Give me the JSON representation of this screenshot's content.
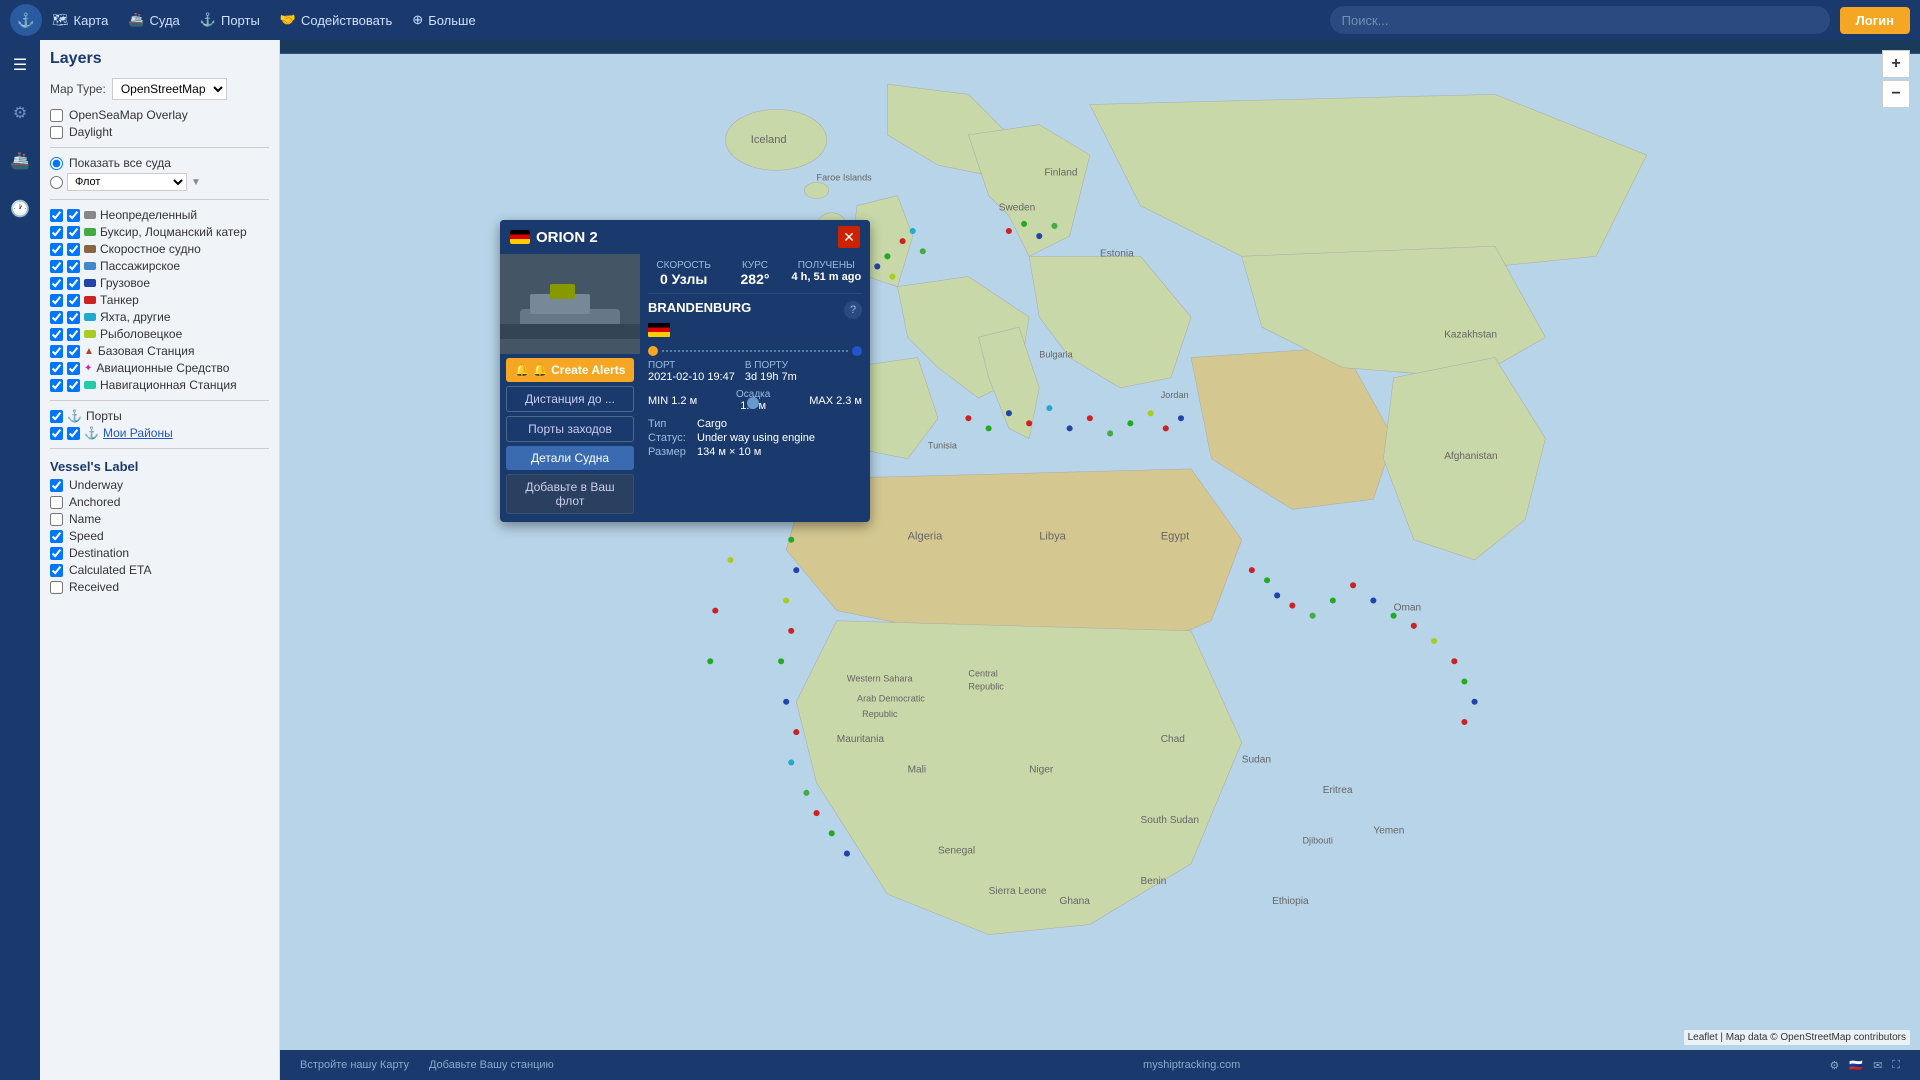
{
  "topnav": {
    "logo": "⚓",
    "items": [
      {
        "label": "Карта",
        "icon": "🗺"
      },
      {
        "label": "Суда",
        "icon": "🚢"
      },
      {
        "label": "Порты",
        "icon": "⚓"
      },
      {
        "label": "Содействовать",
        "icon": "🤝"
      },
      {
        "label": "Больше",
        "icon": "⊕"
      }
    ],
    "search_placeholder": "Поиск...",
    "login_label": "Логин"
  },
  "layers_panel": {
    "title": "Layers",
    "map_type_label": "Map Type:",
    "map_type_value": "OpenStreetMap",
    "overlays": [
      {
        "label": "OpenSeaMap Overlay",
        "checked": false
      },
      {
        "label": "Daylight",
        "checked": false
      }
    ],
    "show_all_label": "Показать все суда",
    "fleet_label": "Флот",
    "vessel_types": [
      {
        "label": "Неопределенный",
        "color": "#888888",
        "type": "bar"
      },
      {
        "label": "Буксир, Лоцманский катер",
        "color": "#44aa44",
        "type": "bar"
      },
      {
        "label": "Скоростное судно",
        "color": "#886644",
        "type": "bar"
      },
      {
        "label": "Пассажирское",
        "color": "#4488cc",
        "type": "bar"
      },
      {
        "label": "Грузовое",
        "color": "#2244aa",
        "type": "bar"
      },
      {
        "label": "Танкер",
        "color": "#cc2222",
        "type": "bar"
      },
      {
        "label": "Яхта, другие",
        "color": "#22aacc",
        "type": "bar"
      },
      {
        "label": "Рыболовецкое",
        "color": "#aacc22",
        "type": "bar"
      },
      {
        "label": "Базовая Станция",
        "color": "#aa4422",
        "type": "triangle"
      },
      {
        "label": "Авиационные Средство",
        "color": "#cc22aa",
        "type": "star"
      },
      {
        "label": "Навигационная Станция",
        "color": "#22ccaa",
        "type": "bar"
      }
    ],
    "extra_types": [
      {
        "label": "Порты",
        "icon": "⚓",
        "checked": true
      },
      {
        "label": "Мои Районы",
        "icon": "⚓",
        "checked": true
      }
    ],
    "vessel_label_title": "Vessel's Label",
    "vessel_labels": [
      {
        "label": "Underway",
        "checked": true
      },
      {
        "label": "Anchored",
        "checked": false
      },
      {
        "label": "Name",
        "checked": false
      },
      {
        "label": "Speed",
        "checked": true
      },
      {
        "label": "Destination",
        "checked": true
      },
      {
        "label": "Calculated ETA",
        "checked": true
      },
      {
        "label": "Received",
        "checked": false
      }
    ]
  },
  "ship_popup": {
    "ship_name": "ORION 2",
    "flag": "DE",
    "stats": {
      "speed_label": "Скорость",
      "speed_value": "0 Узлы",
      "course_label": "Курс",
      "course_value": "282°",
      "received_label": "Получены",
      "received_value": "4 h, 51 m ago"
    },
    "destination": "BRANDENBURG",
    "help_icon": "?",
    "route_from_color": "#f5a623",
    "route_to_color": "#2255cc",
    "port_label": "Порт",
    "port_value": "2021-02-10 19:47",
    "in_port_label": "В ПОРТУ",
    "in_port_value": "3d 19h 7m",
    "draught": {
      "min_label": "MIN 1.2 м",
      "max_label": "MAX 2.3 м",
      "current_label": "Осадка",
      "current_value": "1.3 м"
    },
    "type_label": "Тип",
    "type_value": "Cargo",
    "status_label": "Статус:",
    "status_value": "Under way using engine",
    "size_label": "Размер",
    "size_value": "134 м × 10 м",
    "actions": [
      {
        "label": "🔔 Create Alerts",
        "style": "orange"
      },
      {
        "label": "Дистанция до ...",
        "style": "outline"
      },
      {
        "label": "Порты заходов",
        "style": "outline"
      },
      {
        "label": "Детали Судна",
        "style": "blue-active"
      },
      {
        "label": "Добавьте в Ваш флот",
        "style": "dark"
      }
    ]
  },
  "map_controls": {
    "zoom_in": "+",
    "zoom_out": "−"
  },
  "footer": {
    "left_links": [
      "Встройте нашу Карту",
      "Добавьте Вашу станцию"
    ],
    "center": "myshiptracking.com",
    "attribution": "Leaflet | Map data © OpenStreetMap contributors"
  }
}
